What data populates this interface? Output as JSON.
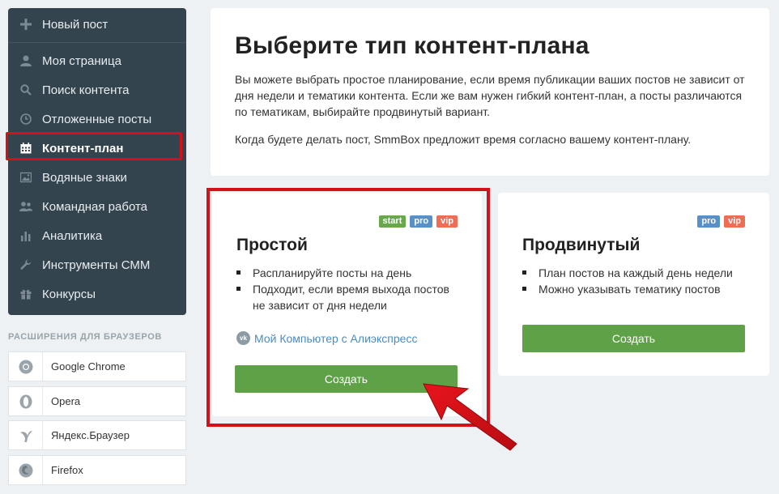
{
  "sidebar": {
    "items": [
      {
        "label": "Новый пост",
        "icon": "plus-icon"
      },
      {
        "label": "Моя страница",
        "icon": "user-icon"
      },
      {
        "label": "Поиск контента",
        "icon": "search-icon"
      },
      {
        "label": "Отложенные посты",
        "icon": "clock-icon"
      },
      {
        "label": "Контент-план",
        "icon": "calendar-icon"
      },
      {
        "label": "Водяные знаки",
        "icon": "image-icon"
      },
      {
        "label": "Командная работа",
        "icon": "users-icon"
      },
      {
        "label": "Аналитика",
        "icon": "bar-chart-icon"
      },
      {
        "label": "Инструменты СММ",
        "icon": "wrench-icon"
      },
      {
        "label": "Конкурсы",
        "icon": "gift-icon"
      }
    ],
    "active": "Контент-план"
  },
  "extensions": {
    "title": "РАСШИРЕНИЯ ДЛЯ БРАУЗЕРОВ",
    "items": [
      {
        "label": "Google Chrome",
        "icon": "chrome-icon"
      },
      {
        "label": "Opera",
        "icon": "opera-icon"
      },
      {
        "label": "Яндекс.Браузер",
        "icon": "yandex-browser-icon"
      },
      {
        "label": "Firefox",
        "icon": "firefox-icon"
      }
    ]
  },
  "intro": {
    "title": "Выберите тип контент-плана",
    "text1": "Вы можете выбрать простое планирование, если время публикации ваших постов не зависит от дня недели и тематики контента. Если же вам нужен гибкий контент-план, а посты различаются по тематикам, выбирайте продвинутый вариант.",
    "text2": "Когда будете делать пост, SmmBox предложит время согласно вашему контент-плану."
  },
  "plans": {
    "simple": {
      "badges": [
        "start",
        "pro",
        "vip"
      ],
      "title": "Простой",
      "features": [
        "Распланируйте посты на день",
        "Подходит, если время выхода постов не зависит от дня недели"
      ],
      "account_label": "Мой Компьютер с Алиэкспресс",
      "account_icon": "vk-icon",
      "button": "Создать"
    },
    "advanced": {
      "badges": [
        "pro",
        "vip"
      ],
      "title": "Продвинутый",
      "features": [
        "План постов на каждый день недели",
        "Можно указывать тематику постов"
      ],
      "button": "Создать"
    }
  },
  "colors": {
    "sidebar_bg": "#34444f",
    "page_bg": "#eef1f3",
    "green_button": "#5fa146",
    "badge_start": "#68a84a",
    "badge_pro": "#5891c8",
    "badge_vip": "#f06c54",
    "highlight_red": "#d3111a"
  }
}
